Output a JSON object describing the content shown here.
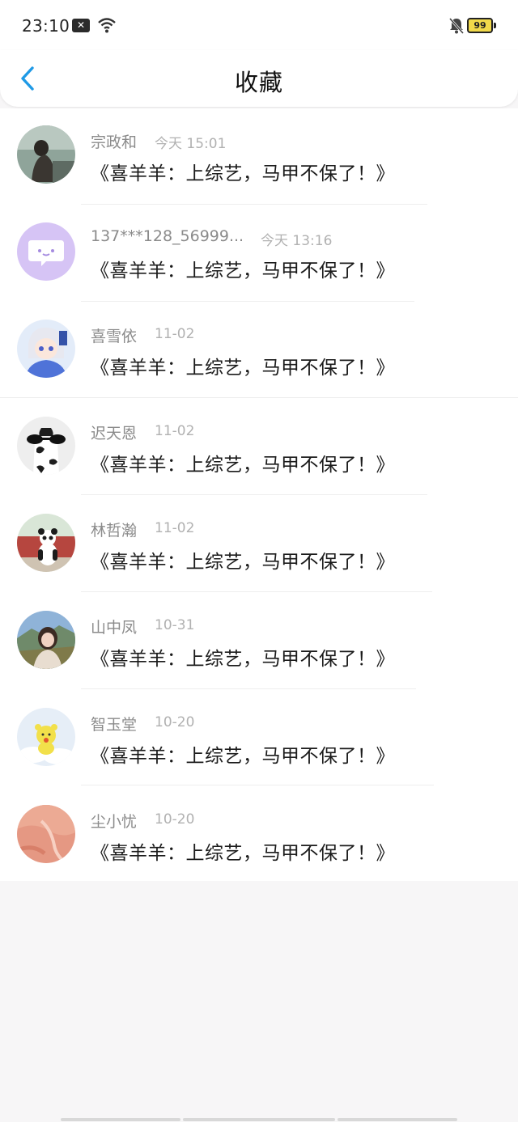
{
  "status_bar": {
    "time": "23:10",
    "notification_icon": "close-box-icon",
    "wifi_icon": "wifi-icon",
    "bell_icon": "bell-off-icon",
    "battery": "99"
  },
  "header": {
    "title": "收藏",
    "back_icon": "chevron-left-icon",
    "accent_color": "#1f9ae6"
  },
  "favorites": [
    {
      "name": "宗政和",
      "time": "今天 15:01",
      "message": "《喜羊羊：上综艺，马甲不保了！》",
      "avatar": "photo-person-icon"
    },
    {
      "name": "137***128_56999...",
      "time": "今天 13:16",
      "message": "《喜羊羊：上综艺，马甲不保了！》",
      "avatar": "chat-bubble-icon"
    },
    {
      "name": "喜雪依",
      "time": "11-02",
      "message": "《喜羊羊：上综艺，马甲不保了！》",
      "avatar": "anime-girl-icon"
    },
    {
      "name": "迟天恩",
      "time": "11-02",
      "message": "《喜羊羊：上综艺，马甲不保了！》",
      "avatar": "cow-sunglasses-icon"
    },
    {
      "name": "林哲瀚",
      "time": "11-02",
      "message": "《喜羊羊：上综艺，马甲不保了！》",
      "avatar": "panda-icon"
    },
    {
      "name": "山中凤",
      "time": "10-31",
      "message": "《喜羊羊：上综艺，马甲不保了！》",
      "avatar": "photo-girl-icon"
    },
    {
      "name": "智玉堂",
      "time": "10-20",
      "message": "《喜羊羊：上综艺，马甲不保了！》",
      "avatar": "yellow-bear-icon"
    },
    {
      "name": "尘小忧",
      "time": "10-20",
      "message": "《喜羊羊：上综艺，马甲不保了！》",
      "avatar": "peach-texture-icon"
    }
  ]
}
